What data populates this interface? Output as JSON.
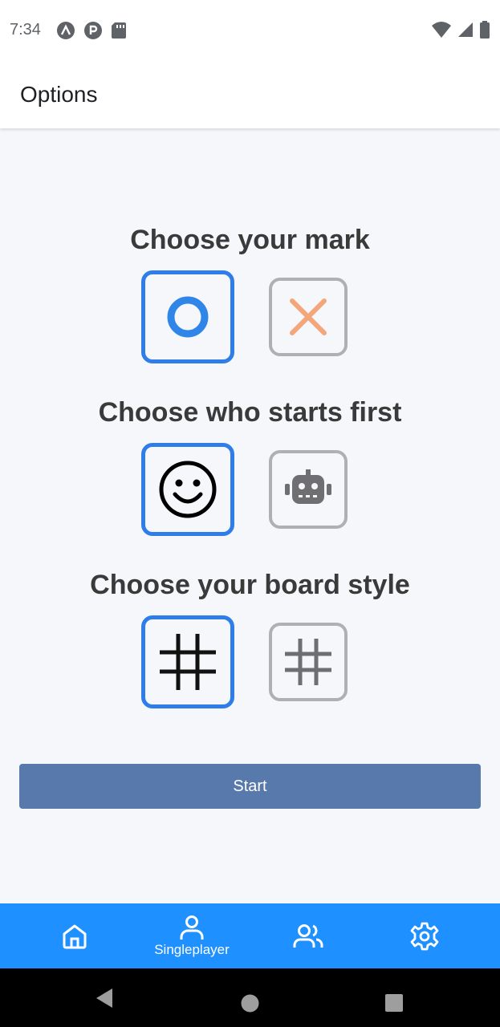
{
  "status_bar": {
    "time": "7:34"
  },
  "app_bar": {
    "title": "Options"
  },
  "sections": {
    "mark": {
      "title": "Choose your mark"
    },
    "first": {
      "title": "Choose who starts first"
    },
    "board": {
      "title": "Choose your board style"
    }
  },
  "start_button": {
    "label": "Start"
  },
  "bottom_nav": {
    "items": [
      {
        "label": "",
        "icon": "home-icon"
      },
      {
        "label": "Singleplayer",
        "icon": "person-icon"
      },
      {
        "label": "",
        "icon": "people-icon"
      },
      {
        "label": "",
        "icon": "gear-icon"
      }
    ]
  },
  "colors": {
    "accent": "#1e90ff",
    "selected_border": "#2f7de9",
    "button": "#5879ab",
    "x_mark": "#f3a67a"
  }
}
